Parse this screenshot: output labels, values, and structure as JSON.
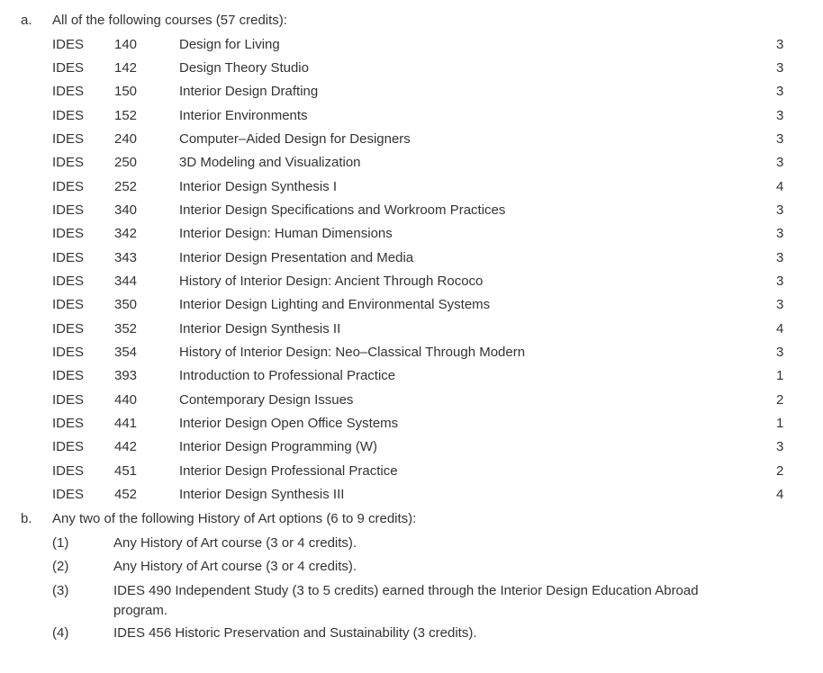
{
  "section_a": {
    "marker": "a.",
    "heading": "All of the following courses (57 credits):",
    "courses": [
      {
        "dept": "IDES",
        "number": "140",
        "title": "Design for Living",
        "credits": "3"
      },
      {
        "dept": "IDES",
        "number": "142",
        "title": "Design Theory Studio",
        "credits": "3"
      },
      {
        "dept": "IDES",
        "number": "150",
        "title": "Interior Design Drafting",
        "credits": "3"
      },
      {
        "dept": "IDES",
        "number": "152",
        "title": "Interior Environments",
        "credits": "3"
      },
      {
        "dept": "IDES",
        "number": "240",
        "title": "Computer–Aided Design for Designers",
        "credits": "3"
      },
      {
        "dept": "IDES",
        "number": "250",
        "title": "3D Modeling and Visualization",
        "credits": "3"
      },
      {
        "dept": "IDES",
        "number": "252",
        "title": "Interior Design Synthesis I",
        "credits": "4"
      },
      {
        "dept": "IDES",
        "number": "340",
        "title": "Interior Design Specifications and Workroom Practices",
        "credits": "3"
      },
      {
        "dept": "IDES",
        "number": "342",
        "title": "Interior Design:  Human Dimensions",
        "credits": "3"
      },
      {
        "dept": "IDES",
        "number": "343",
        "title": "Interior Design Presentation and Media",
        "credits": "3"
      },
      {
        "dept": "IDES",
        "number": "344",
        "title": "History of Interior Design: Ancient Through Rococo",
        "credits": "3"
      },
      {
        "dept": "IDES",
        "number": "350",
        "title": "Interior Design Lighting and Environmental Systems",
        "credits": "3"
      },
      {
        "dept": "IDES",
        "number": "352",
        "title": "Interior Design Synthesis II",
        "credits": "4"
      },
      {
        "dept": "IDES",
        "number": "354",
        "title": "History of Interior Design:  Neo–Classical Through Modern",
        "credits": "3"
      },
      {
        "dept": "IDES",
        "number": "393",
        "title": "Introduction to Professional Practice",
        "credits": "1"
      },
      {
        "dept": "IDES",
        "number": "440",
        "title": "Contemporary Design Issues",
        "credits": "2"
      },
      {
        "dept": "IDES",
        "number": "441",
        "title": "Interior Design Open Office Systems",
        "credits": "1"
      },
      {
        "dept": "IDES",
        "number": "442",
        "title": "Interior Design Programming (W)",
        "credits": "3"
      },
      {
        "dept": "IDES",
        "number": "451",
        "title": "Interior Design Professional Practice",
        "credits": "2"
      },
      {
        "dept": "IDES",
        "number": "452",
        "title": "Interior Design Synthesis III",
        "credits": "4"
      }
    ]
  },
  "section_b": {
    "marker": "b.",
    "heading": "Any two of the following History of Art options (6 to 9 credits):",
    "options": [
      {
        "marker": "(1)",
        "text": "Any History of Art course (3 or 4 credits)."
      },
      {
        "marker": "(2)",
        "text": "Any History of Art course (3 or 4 credits)."
      },
      {
        "marker": "(3)",
        "text": "IDES 490 Independent Study (3 to 5 credits) earned through the Interior Design Education Abroad program."
      },
      {
        "marker": "(4)",
        "text": "IDES 456 Historic Preservation and Sustainability (3 credits)."
      }
    ]
  }
}
